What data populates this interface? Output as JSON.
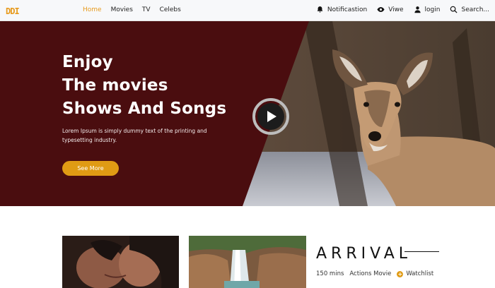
{
  "nav": {
    "logo": "DDI",
    "links": [
      "Home",
      "Movies",
      "TV",
      "Celebs"
    ],
    "notification_label": "Notificastion",
    "view_label": "Viwe",
    "login_label": "login",
    "search_placeholder": "Search..."
  },
  "hero": {
    "title_lines": [
      "Enjoy",
      "The movies",
      "Shows And Songs"
    ],
    "description": "Lorem Ipsum is simply dummy text of the printing and typesetting industry.",
    "button_label": "See More"
  },
  "movie": {
    "title": "ARRIVAL",
    "duration": "150 mins",
    "genre": "Actions Movie",
    "watchlist_label": "Watchlist"
  },
  "colors": {
    "accent": "#e09b14",
    "hero_panel": "#4a0d0f",
    "active_nav": "#e79a1c"
  }
}
